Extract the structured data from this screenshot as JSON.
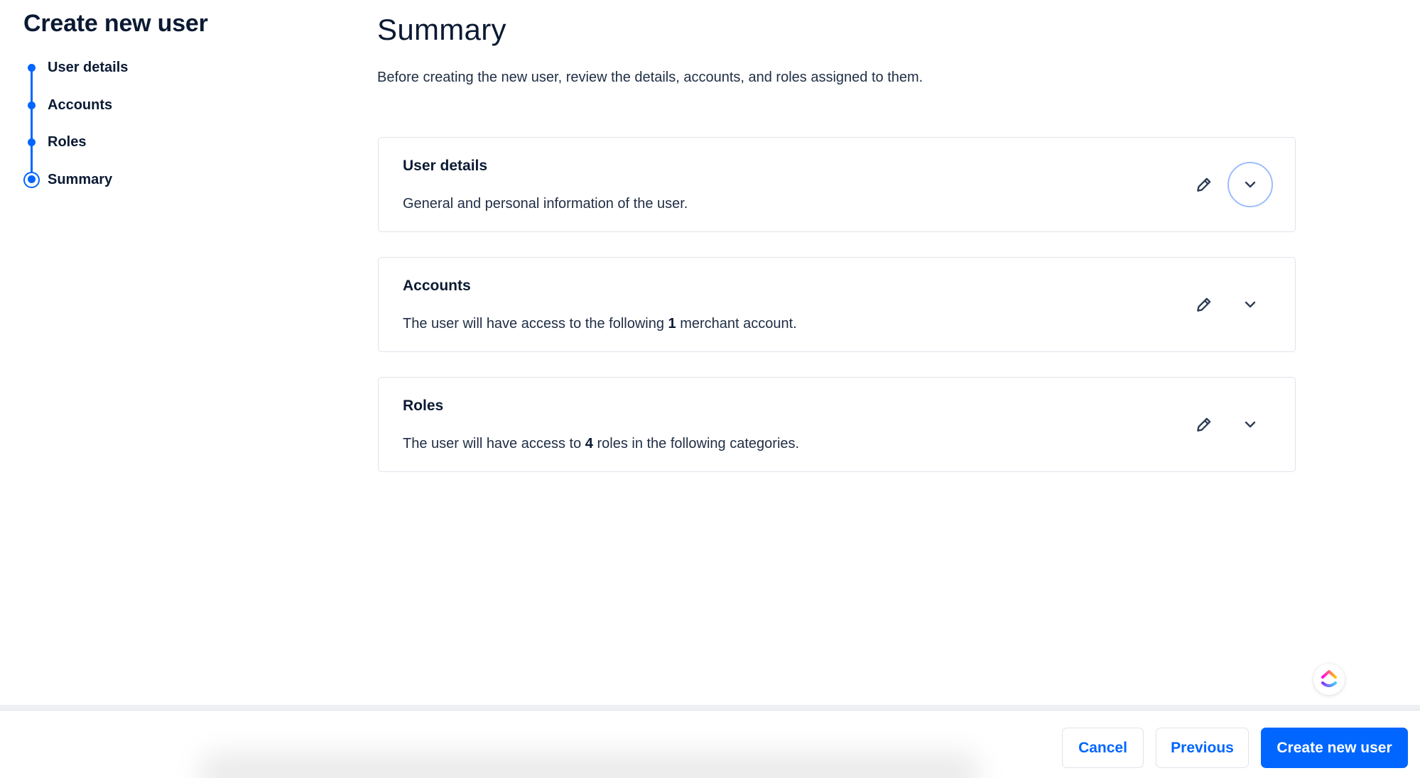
{
  "wizard": {
    "title": "Create new user",
    "steps": [
      {
        "label": "User details",
        "state": "completed"
      },
      {
        "label": "Accounts",
        "state": "completed"
      },
      {
        "label": "Roles",
        "state": "completed"
      },
      {
        "label": "Summary",
        "state": "current"
      }
    ]
  },
  "main": {
    "title": "Summary",
    "subtitle": "Before creating the new user, review the details, accounts, and roles assigned to them.",
    "sections": [
      {
        "title": "User details",
        "description_parts": [
          "General and personal information of the user.",
          "",
          ""
        ],
        "expanded": false,
        "focused": true
      },
      {
        "title": "Accounts",
        "description_parts": [
          "The user will have access to the following ",
          "1",
          " merchant account."
        ],
        "expanded": false,
        "focused": false
      },
      {
        "title": "Roles",
        "description_parts": [
          "The user will have access to ",
          "4",
          " roles in the following categories."
        ],
        "expanded": false,
        "focused": false
      }
    ]
  },
  "icons": {
    "edit": "pencil-icon",
    "expand": "chevron-down-icon",
    "floating": "clickup-logo-icon"
  },
  "footer": {
    "cancel_label": "Cancel",
    "previous_label": "Previous",
    "submit_label": "Create new user"
  },
  "colors": {
    "accent": "#0066ff",
    "focus_ring": "#9cbcff",
    "text": "#0b1a33",
    "border": "#dfe3ea"
  }
}
